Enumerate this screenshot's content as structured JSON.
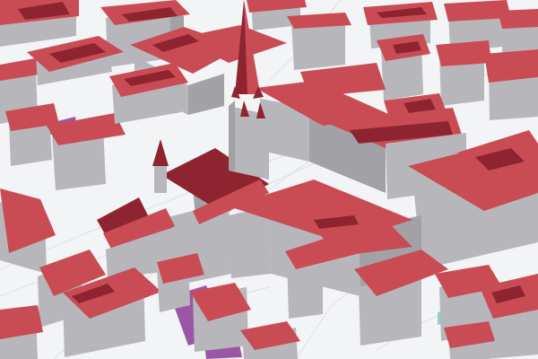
{
  "scene": {
    "view": "3d-city-buildings",
    "colors": {
      "ground": "#f3f4f6",
      "street_line": "#dcdfe4",
      "roof": "#c94c55",
      "roof_dark": "#8e2430",
      "wall": "#b7b7bb",
      "wall_shadow": "#a2a2a6",
      "plaza_purple": "#9b57a6",
      "glass_teal": "#8fd0c2"
    },
    "landmarks": [
      {
        "name": "church-spire",
        "kind": "spire"
      },
      {
        "name": "small-church-tower",
        "kind": "spire"
      }
    ]
  }
}
